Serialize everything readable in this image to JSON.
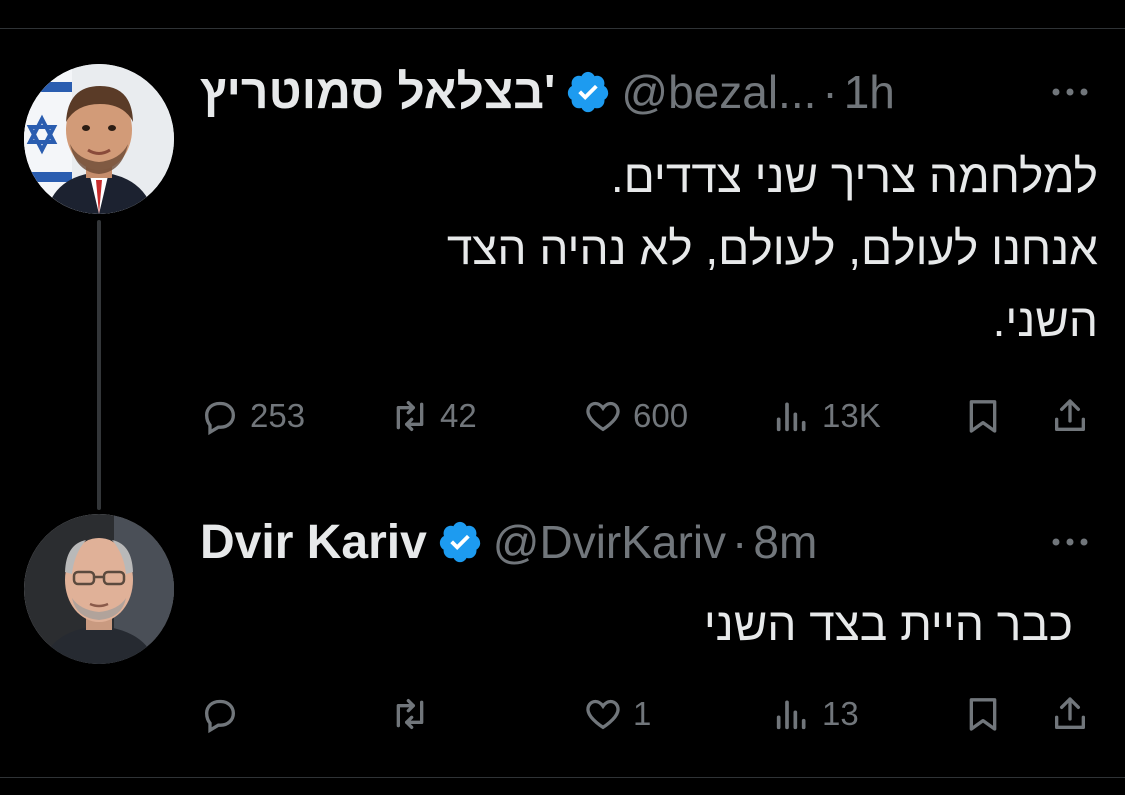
{
  "tweets": [
    {
      "author_name": "בצלאל סמוטריץ'",
      "handle": "@bezal...",
      "separator": "·",
      "time": "1h",
      "text": "למלחמה צריך שני צדדים.\nאנחנו לעולם, לעולם, לא נהיה הצד\nהשני.",
      "verified": true,
      "reply_count": "253",
      "repost_count": "42",
      "like_count": "600",
      "view_count": "13K"
    },
    {
      "author_name": "Dvir Kariv",
      "handle": "@DvirKariv",
      "separator": "·",
      "time": "8m",
      "text": "כבר היית בצד השני",
      "verified": true,
      "reply_count": "",
      "repost_count": "",
      "like_count": "1",
      "view_count": "13"
    }
  ],
  "colors": {
    "background": "#000000",
    "text_primary": "#e7e9ea",
    "text_secondary": "#71767b",
    "verified_badge": "#1d9bf0",
    "divider": "#2f3336"
  },
  "icons": [
    "verified-badge-icon",
    "more-icon",
    "reply-icon",
    "repost-icon",
    "like-icon",
    "views-icon",
    "bookmark-icon",
    "share-icon"
  ]
}
